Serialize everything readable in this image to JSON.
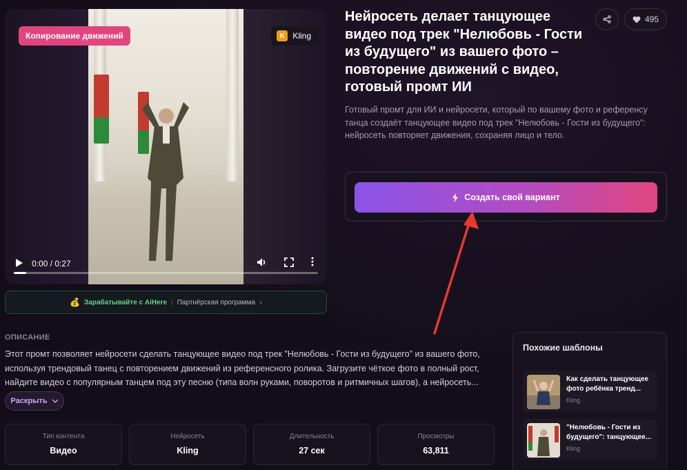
{
  "video": {
    "badge": "Копирование движений",
    "model_badge_letter": "K",
    "model_badge": "Kling",
    "time": "0:00 / 0:27",
    "progress": 0.04
  },
  "affiliate": {
    "coin_icon": "coin-bag-icon",
    "primary": "Зарабатывайте с AiHere",
    "secondary": "Партнёрская программа"
  },
  "header": {
    "title": "Нейросеть делает танцующее видео под трек \"Нелюбовь - Гости из будущего\" из вашего фото – повторение движений с видео, готовый промт ИИ",
    "likes": "495"
  },
  "lead": "Готовый промт для ИИ и нейросети, который по вашему фото и референсу танца создаёт танцующее видео под трек \"Нелюбовь - Гости из будущего\": нейросеть повторяет движения, сохраняя лицо и тело.",
  "cta": {
    "label": "Создать свой вариант"
  },
  "description": {
    "label": "ОПИСАНИЕ",
    "text": "Этот промт позволяет нейросети сделать танцующее видео под трек \"Нелюбовь - Гости из будущего\" из вашего фото, используя трендовый танец с повторением движений из референсного ролика. Загрузите чёткое фото в полный рост, найдите видео с популярным танцем под эту песню (типа волн руками, поворотов и ритмичных шагов), а нейросеть...",
    "expand": "Раскрыть"
  },
  "stats": [
    {
      "label": "Тип контента",
      "value": "Видео"
    },
    {
      "label": "Нейросеть",
      "value": "Kling"
    },
    {
      "label": "Длительность",
      "value": "27 сек"
    },
    {
      "label": "Просмотры",
      "value": "63,811"
    }
  ],
  "similar": {
    "title": "Похожие шаблоны",
    "items": [
      {
        "title": "Как сделать танцующее фото ребёнка тренд...",
        "sub": "Kling"
      },
      {
        "title": "\"Нелюбовь - Гости из будущего\": танцующее...",
        "sub": "Kling"
      }
    ]
  },
  "colors": {
    "accent_start": "#8a54e8",
    "accent_end": "#e0467f",
    "badge_pink": "#e0457e",
    "affiliate_green": "#62d28a",
    "annotation_arrow": "#e8392e"
  }
}
